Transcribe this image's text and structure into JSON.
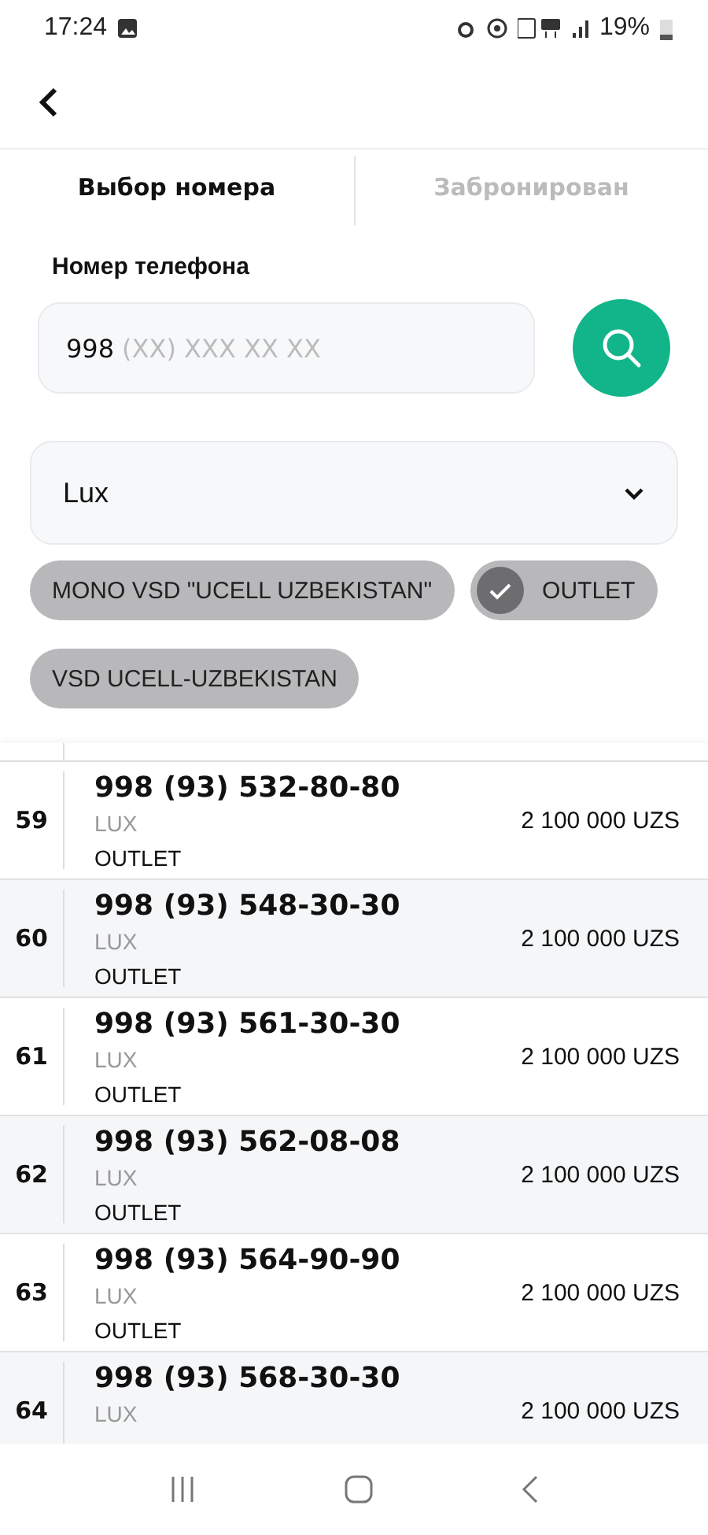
{
  "status_bar": {
    "time": "17:24",
    "battery": "19%"
  },
  "tabs": [
    {
      "label": "Выбор номера",
      "selected": true
    },
    {
      "label": "Забронирован",
      "selected": false
    }
  ],
  "phone_field": {
    "label": "Номер телефона",
    "value": "998",
    "placeholder": "(XX) XXX XX XX"
  },
  "category_select": {
    "value": "Lux"
  },
  "filters": [
    {
      "label": "MONO VSD \"UCELL UZBEKISTAN\"",
      "selected": false
    },
    {
      "label": "OUTLET",
      "selected": true
    },
    {
      "label": "VSD UCELL-UZBEKISTAN",
      "selected": false
    }
  ],
  "numbers": [
    {
      "index": "59",
      "number": "998 (93) 532-80-80",
      "category": "LUX",
      "dealer": "OUTLET",
      "price": "2 100 000 UZS"
    },
    {
      "index": "60",
      "number": "998 (93) 548-30-30",
      "category": "LUX",
      "dealer": "OUTLET",
      "price": "2 100 000 UZS"
    },
    {
      "index": "61",
      "number": "998 (93) 561-30-30",
      "category": "LUX",
      "dealer": "OUTLET",
      "price": "2 100 000 UZS"
    },
    {
      "index": "62",
      "number": "998 (93) 562-08-08",
      "category": "LUX",
      "dealer": "OUTLET",
      "price": "2 100 000 UZS"
    },
    {
      "index": "63",
      "number": "998 (93) 564-90-90",
      "category": "LUX",
      "dealer": "OUTLET",
      "price": "2 100 000 UZS"
    },
    {
      "index": "64",
      "number": "998 (93) 568-30-30",
      "category": "LUX",
      "price": "2 100 000 UZS"
    }
  ]
}
